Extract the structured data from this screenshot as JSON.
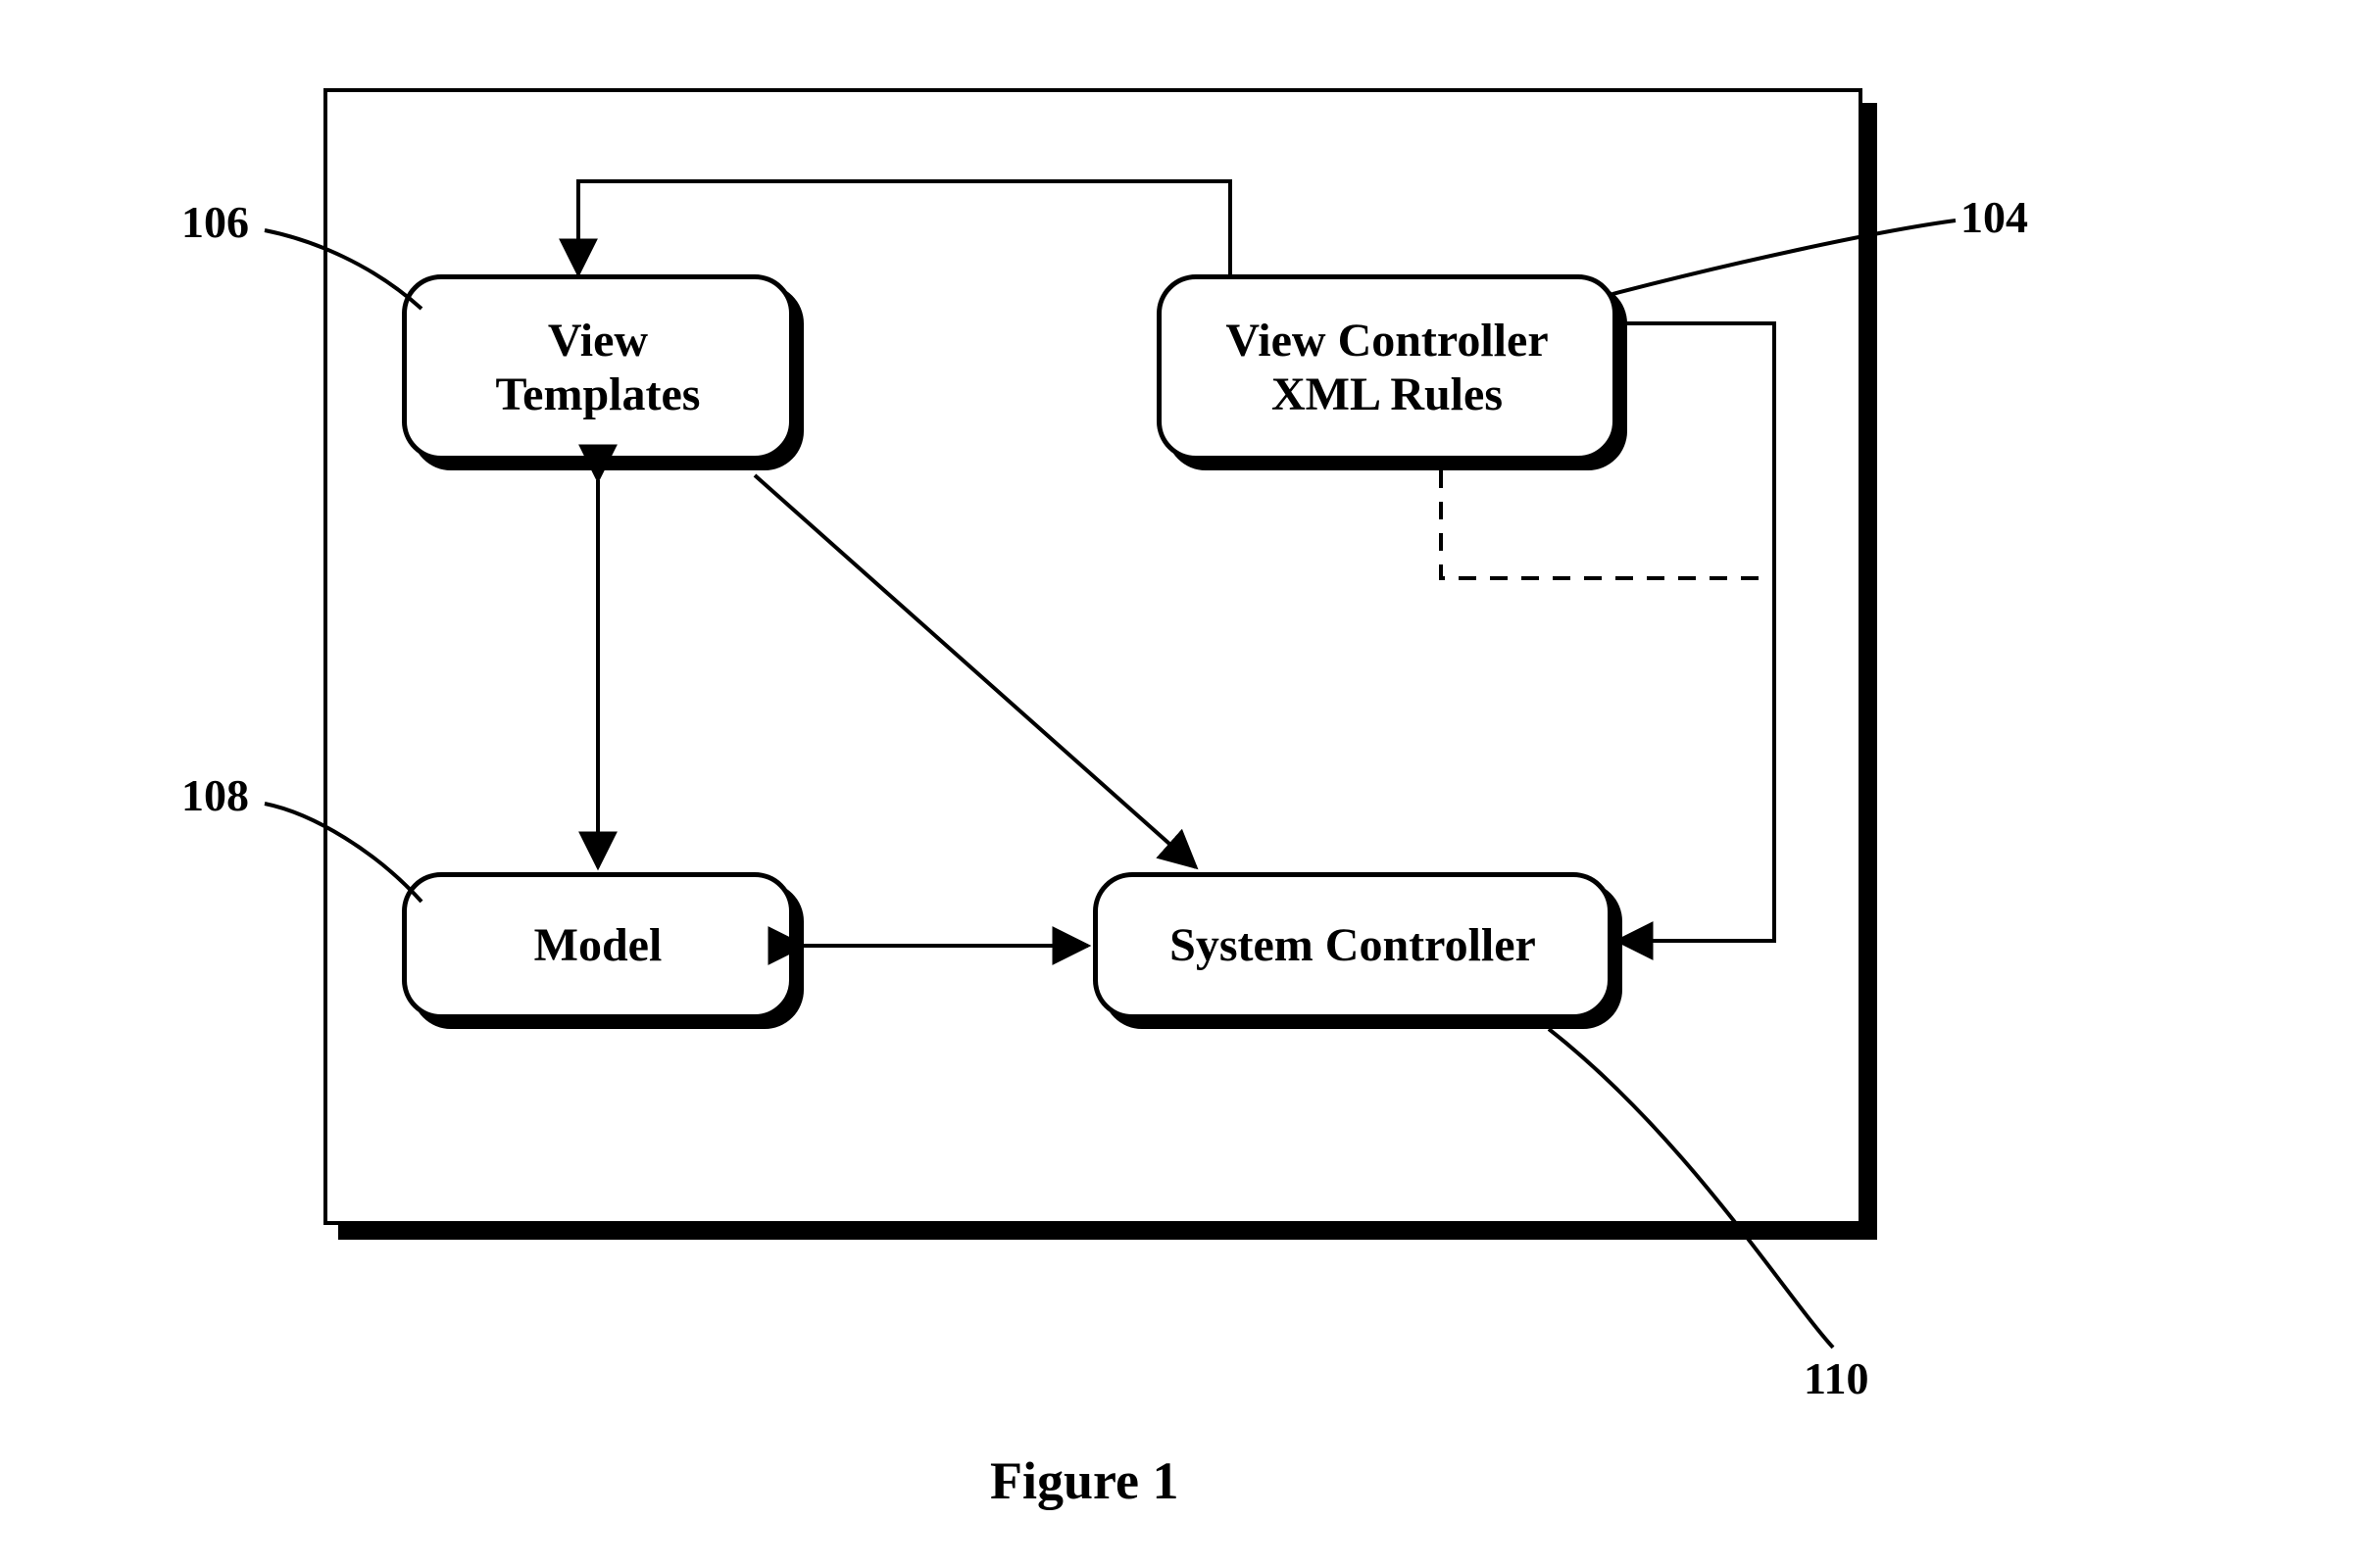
{
  "figure_caption": "Figure 1",
  "boxes": {
    "view_templates": {
      "ref": "106",
      "label": "View\nTemplates"
    },
    "view_controller": {
      "ref": "104",
      "label": "View Controller\nXML Rules"
    },
    "model": {
      "ref": "108",
      "label": "Model"
    },
    "system_controller": {
      "ref": "110",
      "label": "System Controller"
    }
  },
  "diagram": {
    "type": "block-diagram",
    "nodes": [
      "View Templates (106)",
      "View Controller XML Rules (104)",
      "Model (108)",
      "System Controller (110)"
    ],
    "edges": [
      {
        "from": "View Controller XML Rules",
        "to": "View Templates",
        "style": "solid",
        "direction": "uni",
        "route": "orthogonal-top"
      },
      {
        "from": "View Controller XML Rules",
        "to": "System Controller",
        "style": "solid",
        "direction": "uni",
        "route": "orthogonal-right"
      },
      {
        "from": "View Controller XML Rules",
        "to": "System Controller_area",
        "style": "dashed",
        "direction": "none",
        "route": "orthogonal-below"
      },
      {
        "from": "View Templates",
        "to": "Model",
        "style": "solid",
        "direction": "bi",
        "route": "vertical"
      },
      {
        "from": "View Templates",
        "to": "System Controller",
        "style": "solid",
        "direction": "uni",
        "route": "diagonal"
      },
      {
        "from": "Model",
        "to": "System Controller",
        "style": "solid",
        "direction": "bi",
        "route": "horizontal"
      }
    ]
  }
}
